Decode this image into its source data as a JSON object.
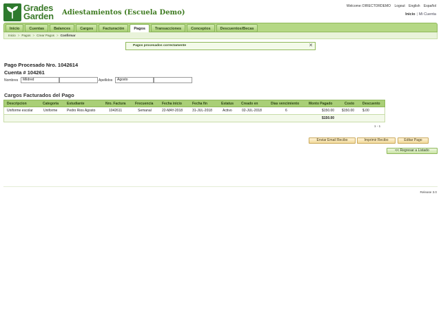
{
  "header": {
    "logo_line1": "Grades",
    "logo_line2": "Garden",
    "school_name": "Adiestamientos (Escuela Demo)",
    "welcome_label": "Welcome:",
    "username": "DIRECTORDEMO",
    "logout": "Logout",
    "english": "English",
    "espanol": "Español",
    "home": "Inicio",
    "separator": "|",
    "my_account": "Mi Cuenta"
  },
  "nav": {
    "items": [
      "Inicio",
      "Cuentas",
      "Balances",
      "Cargos",
      "Facturación",
      "Pagos",
      "Transacciones",
      "Conceptos",
      "Descuentos/Becas"
    ],
    "active": "Pagos"
  },
  "breadcrumb": {
    "items": [
      "Inicio",
      "Pagos",
      "Crear Pagos"
    ],
    "current": "Confirmar",
    "separator": ">"
  },
  "alert": {
    "message": "Pagos procesados correctamente",
    "close": "✕"
  },
  "payment": {
    "title": "Pago Procesado Nro. 1042614",
    "account": "Cuenta # 104261",
    "names_label": "Nombres",
    "first_name": "Mildred",
    "second_name": "",
    "last_names_label": "Apellidos",
    "last_name": "Agosto",
    "second_last_name": ""
  },
  "charges": {
    "section_title": "Cargos Facturados del Pago",
    "columns": [
      "Descripcion",
      "Categoria",
      "Estudiante",
      "Nro. Factura",
      "Frecuencia",
      "Fecha inicio",
      "Fecha fin",
      "Estatus",
      "Creado en",
      "Dias vencimiento",
      "Monto Pagado",
      "Costo",
      "Descuento"
    ],
    "rows": [
      [
        "Uniforme escolar",
        "Uniforme",
        "Pedro Rios Agosto",
        "1042611",
        "Semanal",
        "22-MAY-2018",
        "31-JUL-2018",
        "Activo",
        "02-JUL-2018",
        "6",
        "$150.00",
        "$150.00",
        "$.00"
      ]
    ],
    "total_paid": "$150.00",
    "pager": "1 - 1"
  },
  "actions": {
    "send_email": "Enviar Email Recibo",
    "print_receipt": "Imprimir Recibo",
    "edit_payment": "Editar Pago",
    "back_to_list": "<< Regresar a Listado"
  },
  "footer": {
    "release": "Release 3.0"
  },
  "colors": {
    "nav_green": "#b5d885",
    "header_text_green": "#3d7a1f",
    "button_orange": "#f1d99a"
  }
}
